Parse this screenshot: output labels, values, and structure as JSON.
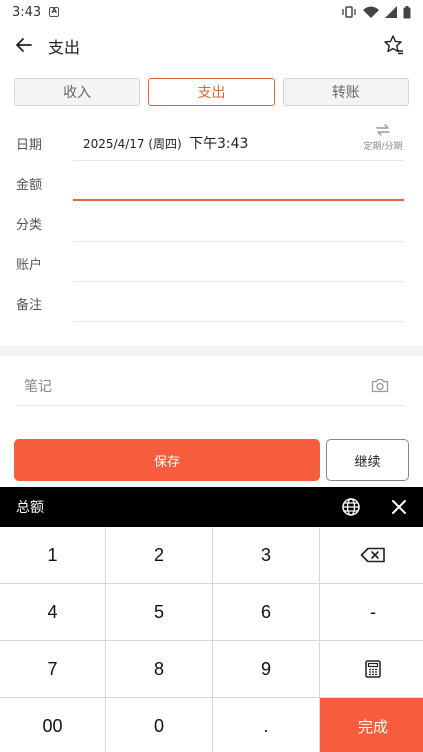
{
  "status_bar": {
    "time": "3:43",
    "notification_badge": "A"
  },
  "header": {
    "title": "支出"
  },
  "tabs": [
    {
      "label": "收入",
      "active": false
    },
    {
      "label": "支出",
      "active": true
    },
    {
      "label": "转账",
      "active": false
    }
  ],
  "form": {
    "date_label": "日期",
    "date_value": "2025/4/17 (周四)",
    "time_value": "下午3:43",
    "repeat_label": "定期/分期",
    "amount_label": "金额",
    "category_label": "分类",
    "account_label": "账户",
    "memo_label": "备注"
  },
  "note": {
    "placeholder": "笔记"
  },
  "actions": {
    "save_label": "保存",
    "continue_label": "继续"
  },
  "keypad": {
    "title": "总额",
    "keys": [
      "1",
      "2",
      "3",
      "4",
      "5",
      "6",
      "-",
      "7",
      "8",
      "9",
      "00",
      "0",
      ".",
      "完成"
    ]
  },
  "colors": {
    "accent": "#f75d3d",
    "tab_active": "#e0663d",
    "keypad_bar": "#000000"
  }
}
